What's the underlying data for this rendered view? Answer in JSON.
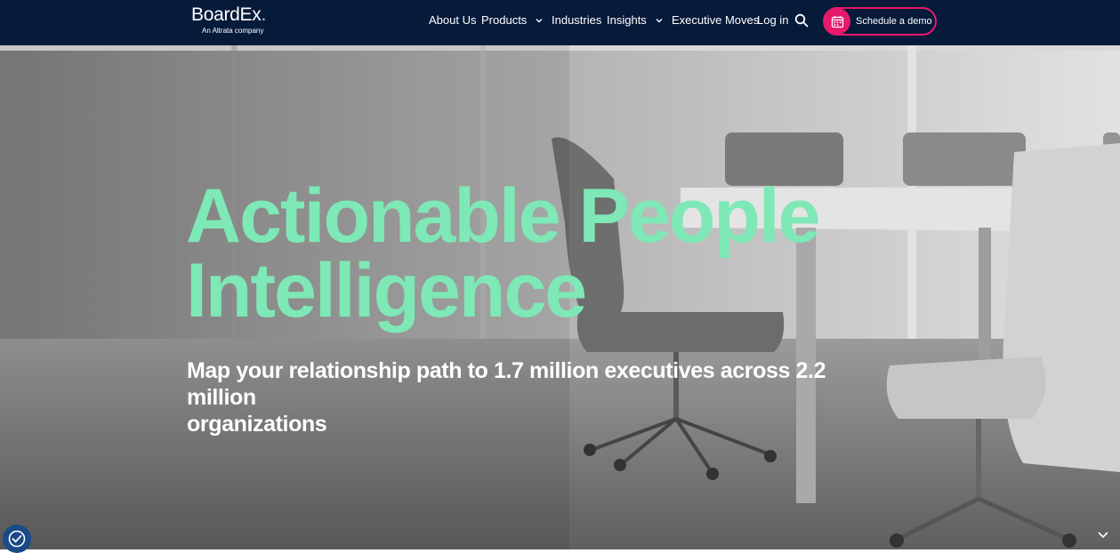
{
  "header": {
    "logo": {
      "name": "BoardEx",
      "dot": ".",
      "tagline": "An Altrata company"
    },
    "nav": [
      {
        "label": "About Us",
        "has_dropdown": false
      },
      {
        "label": "Products",
        "has_dropdown": true
      },
      {
        "label": "Industries",
        "has_dropdown": false
      },
      {
        "label": "Insights",
        "has_dropdown": true
      },
      {
        "label": "Executive Moves",
        "has_dropdown": false
      },
      {
        "label": "Log in",
        "has_dropdown": false
      }
    ],
    "search_icon": "search-icon",
    "cta": {
      "label": "Schedule a demo",
      "icon": "calendar-icon"
    }
  },
  "hero": {
    "title_line1": "Actionable People",
    "title_line2": "Intelligence",
    "subtitle_line1": "Map your relationship path to 1.7 million executives across 2.2 million",
    "subtitle_line2": "organizations"
  },
  "colors": {
    "header_bg": "#061a3a",
    "accent_green": "#7ee8b6",
    "accent_pink": "#e6196b",
    "cookie_blue": "#1a4a8a"
  },
  "widgets": {
    "cookie_settings_icon": "cookie-consent-icon",
    "scroll_icon": "chevron-down-icon"
  }
}
